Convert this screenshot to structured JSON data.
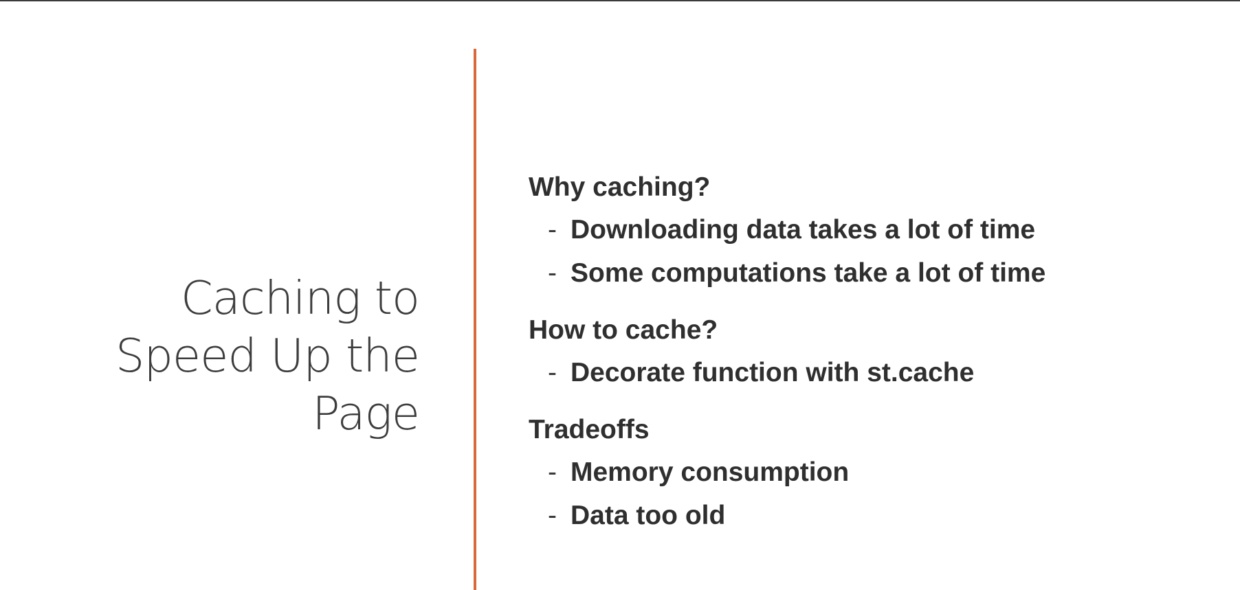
{
  "slide": {
    "title_lines": [
      "Caching to",
      "Speed Up the",
      "Page"
    ],
    "bullet_marker": "-",
    "sections": [
      {
        "heading": "Why caching?",
        "bullets": [
          "Downloading data takes a lot of time",
          "Some computations take a lot of time"
        ]
      },
      {
        "heading": "How to cache?",
        "bullets": [
          "Decorate function with st.cache"
        ]
      },
      {
        "heading": "Tradeoffs",
        "bullets": [
          "Memory consumption",
          "Data too old"
        ]
      }
    ]
  },
  "colors": {
    "accent_divider": "#d9683a",
    "text": "#2f2f2f",
    "title_text": "#3d3d3d",
    "background": "#ffffff"
  }
}
